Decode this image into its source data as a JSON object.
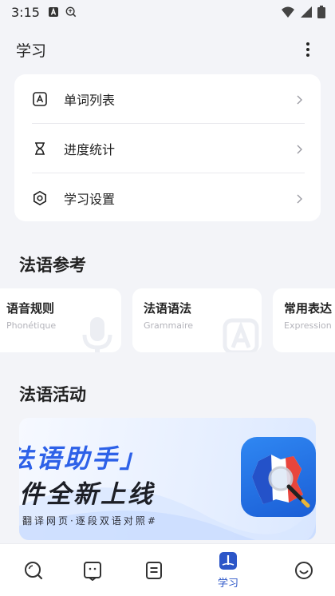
{
  "status_bar": {
    "time": "3:15",
    "icons": [
      "notification-a-icon",
      "translate-icon",
      "wifi-icon",
      "signal-icon",
      "battery-icon"
    ]
  },
  "header": {
    "title": "学习",
    "more_icon": "more-vertical-icon"
  },
  "menu": [
    {
      "label": "单词列表",
      "icon": "letter-a-icon"
    },
    {
      "label": "进度统计",
      "icon": "hourglass-icon"
    },
    {
      "label": "学习设置",
      "icon": "settings-hexagon-icon"
    }
  ],
  "reference": {
    "title": "法语参考",
    "cards": [
      {
        "title": "语音规则",
        "subtitle": "Phonétique",
        "icon": "microphone-icon"
      },
      {
        "title": "法语语法",
        "subtitle": "Grammaire",
        "icon": "letter-a-icon"
      },
      {
        "title": "常用表达",
        "subtitle": "Expression",
        "icon": "chat-icon"
      }
    ]
  },
  "activities": {
    "title": "法语活动",
    "banner": {
      "line1": "法语助手」",
      "line2": "件全新上线",
      "line3": "翻译网页·逐段双语对照#"
    }
  },
  "tab_bar": {
    "items": [
      {
        "name": "search",
        "icon": "search-icon",
        "label": ""
      },
      {
        "name": "chat",
        "icon": "chat-bubble-icon",
        "label": ""
      },
      {
        "name": "notes",
        "icon": "notes-icon",
        "label": ""
      },
      {
        "name": "study",
        "icon": "book-icon",
        "label": "学习",
        "active": true
      },
      {
        "name": "me",
        "icon": "smiley-icon",
        "label": ""
      }
    ]
  },
  "colors": {
    "accent": "#2c56c8",
    "background": "#f3f4f8",
    "banner_blue": "#2d61e8"
  }
}
